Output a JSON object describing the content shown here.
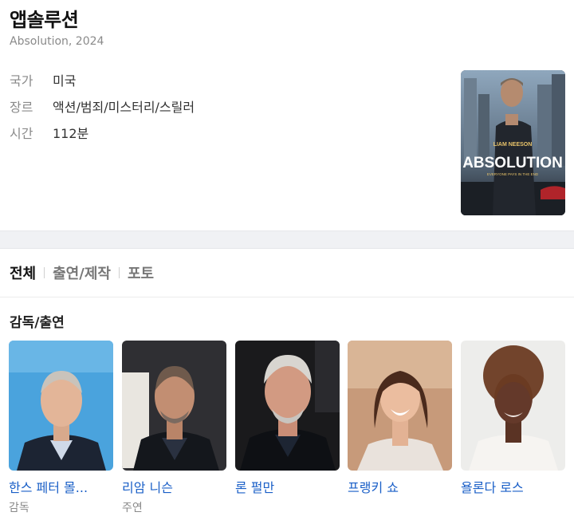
{
  "movie": {
    "title": "앱솔루션",
    "subtitle": "Absolution, 2024",
    "info": [
      {
        "label": "국가",
        "value": "미국"
      },
      {
        "label": "장르",
        "value": "액션/범죄/미스터리/스릴러"
      },
      {
        "label": "시간",
        "value": "112분"
      }
    ],
    "poster": {
      "actor_text": "LIAM NEESON",
      "title_text": "ABSOLUTION",
      "tagline": "EVERYONE PAYS IN THE END"
    }
  },
  "tabs": [
    {
      "label": "전체",
      "active": true
    },
    {
      "label": "출연/제작",
      "active": false
    },
    {
      "label": "포토",
      "active": false
    }
  ],
  "cast_section": {
    "title": "감독/출연",
    "members": [
      {
        "name": "한스 페터 몰...",
        "role": "감독"
      },
      {
        "name": "리암 니슨",
        "role": "주연"
      },
      {
        "name": "론 펄만",
        "role": ""
      },
      {
        "name": "프랭키 쇼",
        "role": ""
      },
      {
        "name": "욜론다 로스",
        "role": ""
      }
    ]
  },
  "colors": {
    "link": "#1a5fc7",
    "label_gray": "#8a8a8a",
    "band": "#f0f1f4"
  }
}
